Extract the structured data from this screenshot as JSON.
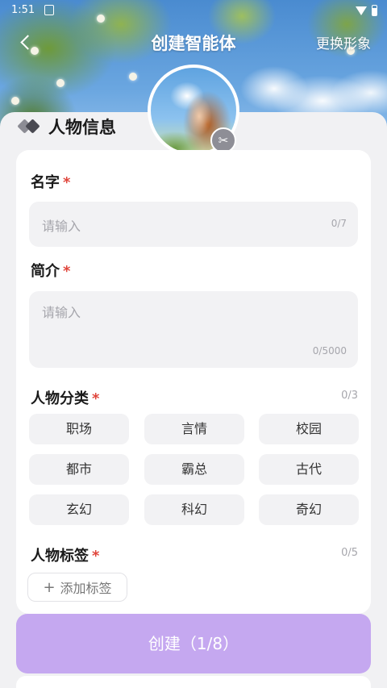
{
  "status_bar": {
    "time": "1:51"
  },
  "nav": {
    "title": "创建智能体",
    "right_action": "更换形象"
  },
  "section": {
    "title": "人物信息"
  },
  "form": {
    "name": {
      "label": "名字",
      "required_mark": "*",
      "placeholder": "请输入",
      "counter": "0/7"
    },
    "intro": {
      "label": "简介",
      "required_mark": "*",
      "placeholder": "请输入",
      "counter": "0/5000"
    },
    "category": {
      "label": "人物分类",
      "required_mark": "*",
      "counter": "0/3",
      "options": [
        "职场",
        "言情",
        "校园",
        "都市",
        "霸总",
        "古代",
        "玄幻",
        "科幻",
        "奇幻"
      ]
    },
    "tags": {
      "label": "人物标签",
      "required_mark": "*",
      "counter": "0/5",
      "add_label": "添加标签"
    }
  },
  "create_button": {
    "label": "创建（1/8）"
  },
  "icons": {
    "back": "chevron-left-icon",
    "scissors": "scissors-icon",
    "section": "diamond-icon",
    "add": "plus-icon"
  }
}
